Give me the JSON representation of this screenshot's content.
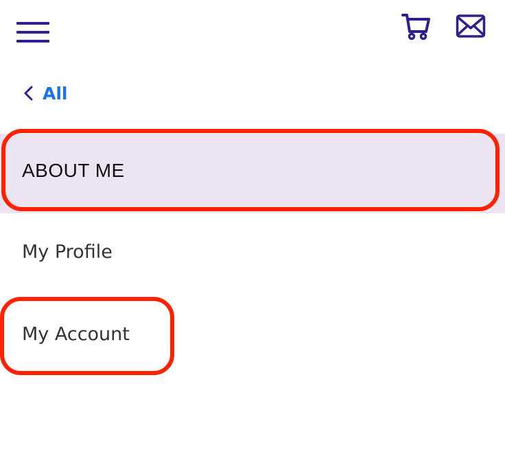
{
  "header": {
    "menu_icon": "hamburger-menu-icon",
    "cart_icon": "shopping-cart-icon",
    "mail_icon": "envelope-icon"
  },
  "nav": {
    "back_label": "All",
    "back_icon": "chevron-left-icon"
  },
  "section": {
    "title": "ABOUT ME"
  },
  "menu": {
    "items": [
      {
        "label": "My Profile"
      },
      {
        "label": "My Account"
      }
    ]
  },
  "colors": {
    "icon_primary": "#2e1f8f",
    "link_blue": "#1a73e8",
    "section_bg": "#ede4f3",
    "highlight_red": "#ff2200",
    "text_dark": "#111111",
    "text_item": "#333333"
  }
}
